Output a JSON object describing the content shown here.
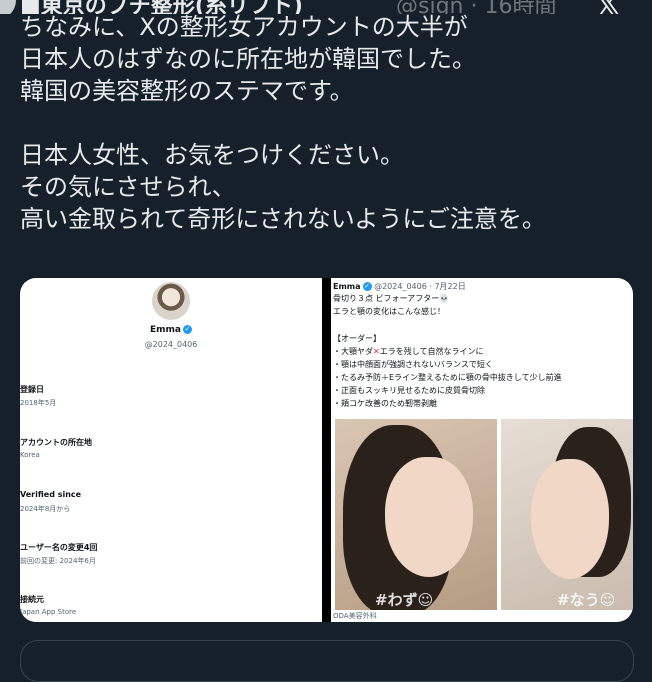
{
  "header": {
    "display_name": "■東京のプチ整形(糸リフト)",
    "handle": "@sign · 16時間",
    "logo": "x-logo"
  },
  "tweet": {
    "lines": [
      "ちなみに、Xの整形女アカウントの大半が",
      "日本人のはずなのに所在地が韓国でした。",
      "韓国の美容整形のステマです。",
      "",
      "日本人女性、お気をつけください。",
      "その気にさせられ、",
      "高い金取られて奇形にされないようにご注意を。"
    ]
  },
  "media": {
    "left": {
      "name": "Emma",
      "handle": "@2024_0406",
      "fields": [
        {
          "label": "登録日",
          "value": "2018年5月"
        },
        {
          "label": "アカウントの所在地",
          "value": "Korea"
        },
        {
          "label": "Verified since",
          "value": "2024年8月から"
        },
        {
          "label": "ユーザー名の変更4回",
          "value": "前回の変更: 2024年6月"
        },
        {
          "label": "接続元",
          "value": "Japan App Store"
        }
      ]
    },
    "right": {
      "name": "Emma",
      "meta": "@2024_0406 · 7月22日",
      "line1": "骨切り３点 ビフォーアフター💀",
      "line2": "エラと顎の変化はこんな感じ！",
      "order_title": "【オーダー】",
      "items": [
        "・大顎ヤダ",
        "・顎は中顔面が強調されないバランスで短く",
        "・たるみ予防＋Eライン整えるために顎の骨中抜きして少し前進",
        "・正面もスッキリ見せるために皮質骨切除",
        "・頬コケ改善のため靭帯剥離"
      ],
      "item1_suffix": "エラを残して自然なラインに",
      "caption_before": "#わず☺",
      "caption_after": "#なう☺",
      "clinic": "ODA美容外科"
    }
  },
  "colors": {
    "background": "#15202b",
    "text": "#e7e9ea",
    "muted": "#71767b",
    "verified": "#1d9bf0",
    "red_x": "#e0245e"
  }
}
